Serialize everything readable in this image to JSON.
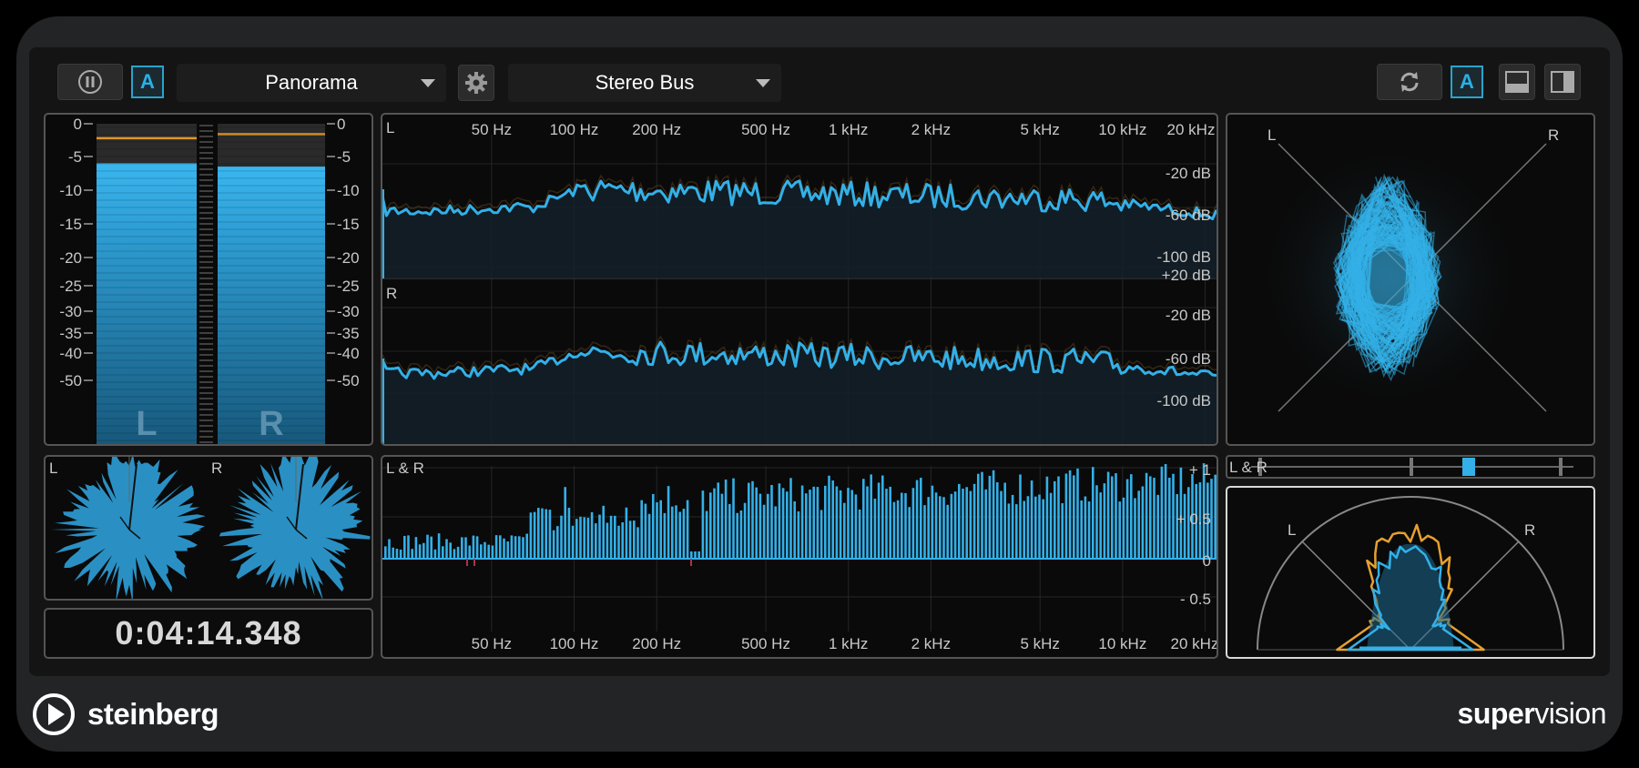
{
  "toolbar": {
    "pause_icon": "pause-icon",
    "auto_label": "A",
    "module_select": "Panorama",
    "settings_icon": "gear-icon",
    "bus_select": "Stereo Bus",
    "sync_icon": "sync-icon",
    "auto_label_right": "A",
    "layout_bottom_icon": "layout-bottom-icon",
    "layout_right_icon": "layout-right-icon"
  },
  "level_meter": {
    "left_scale": [
      "0",
      "-5",
      "-10",
      "-15",
      "-20",
      "-25",
      "-30",
      "-35",
      "-40",
      "-50"
    ],
    "right_scale": [
      "0",
      "-5",
      "-10",
      "-15",
      "-20",
      "-25",
      "-30",
      "-35",
      "-40",
      "-50"
    ],
    "left_label": "L",
    "right_label": "R",
    "left_level_db": -6,
    "right_level_db": -6.5,
    "left_peak_db": -2.2,
    "right_peak_db": -1.6
  },
  "spectrum": {
    "left_channel": "L",
    "right_channel": "R",
    "freq_labels": [
      "50 Hz",
      "100 Hz",
      "200 Hz",
      "500 Hz",
      "1 kHz",
      "2 kHz",
      "5 kHz",
      "10 kHz",
      "20 kHz"
    ],
    "db_labels_top": [
      "-20 dB",
      "-60 dB",
      "-100 dB"
    ],
    "db_labels_bottom": [
      "+20 dB",
      "-20 dB",
      "-60 dB",
      "-100 dB"
    ]
  },
  "correlation": {
    "label": "L & R",
    "scale": [
      "+ 1",
      "+ 0.5",
      "0",
      "- 0.5"
    ],
    "freq_labels": [
      "50 Hz",
      "100 Hz",
      "200 Hz",
      "500 Hz",
      "1 kHz",
      "2 kHz",
      "5 kHz",
      "10 kHz",
      "20 kHz"
    ]
  },
  "phase_scope": {
    "left": "L",
    "right": "R"
  },
  "balance": {
    "label": "L & R"
  },
  "panorama": {
    "left": "L",
    "right": "R"
  },
  "radar": {
    "left": "L",
    "right": "R"
  },
  "time": "0:04:14.348",
  "brand": {
    "logo_icon": "steinberg-logo-icon",
    "name": "steinberg"
  },
  "product": {
    "bold": "super",
    "light": "vision"
  },
  "colors": {
    "accent": "#33b0e8",
    "orange": "#e6a030",
    "panel": "#0a0a0a",
    "border": "#555555"
  }
}
